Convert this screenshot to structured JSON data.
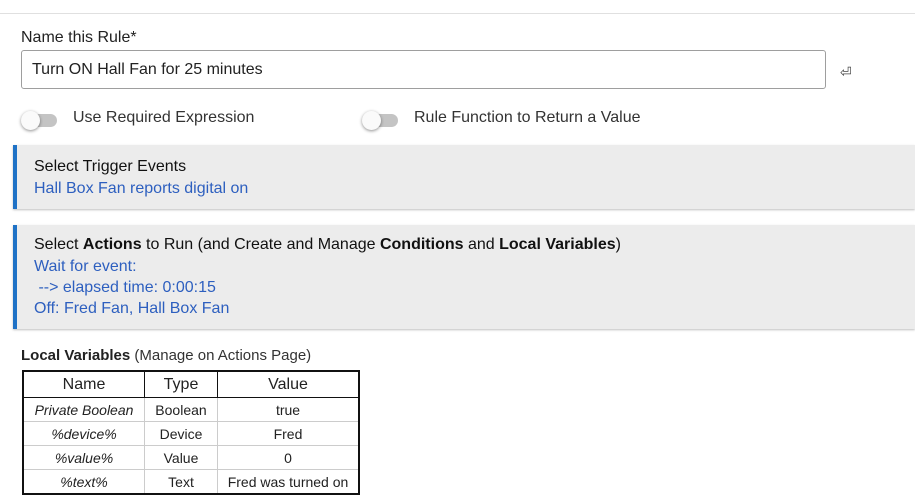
{
  "rule": {
    "name_label": "Name this Rule*",
    "name_value": "Turn ON Hall Fan for 25 minutes",
    "enter_icon": "⏎"
  },
  "toggles": [
    {
      "label": "Use Required Expression",
      "on": false
    },
    {
      "label": "Rule Function to Return a Value",
      "on": false
    }
  ],
  "triggers": {
    "title": "Select Trigger Events",
    "lines": [
      "Hall Box Fan reports digital on"
    ]
  },
  "actions": {
    "title_parts": [
      "Select ",
      "Actions",
      " to Run (and Create and Manage ",
      "Conditions",
      " and ",
      "Local Variables",
      ")"
    ],
    "lines": [
      "Wait for event:",
      " --> elapsed time: 0:00:15",
      "Off: Fred Fan, Hall Box Fan"
    ]
  },
  "local_vars": {
    "title_bold": "Local Variables",
    "title_rest": " (Manage on Actions Page)",
    "headers": [
      "Name",
      "Type",
      "Value"
    ],
    "rows": [
      [
        "Private Boolean",
        "Boolean",
        "true"
      ],
      [
        "%device%",
        "Device",
        "Fred"
      ],
      [
        "%value%",
        "Value",
        "0"
      ],
      [
        "%text%",
        "Text",
        "Fred was turned on"
      ]
    ]
  },
  "colors": {
    "accent": "#1f72c6",
    "link": "#2d5fbf",
    "section_bg": "#ececec"
  }
}
